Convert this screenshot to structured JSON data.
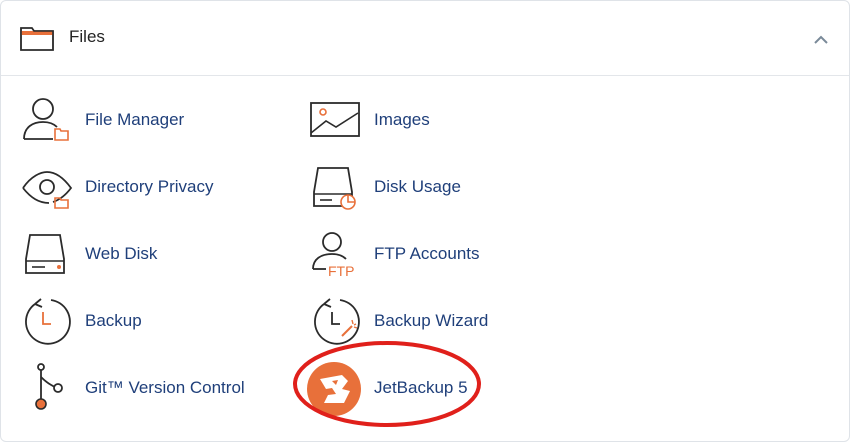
{
  "section": {
    "title": "Files",
    "collapse_icon": "chevron-up-icon",
    "header_icon": "folder-icon"
  },
  "colors": {
    "accent": "#e8703a",
    "link": "#1f3f7a",
    "icon_stroke": "#2b2b2b",
    "highlight": "#e0201b"
  },
  "items": [
    {
      "label": "File Manager",
      "icon": "file-manager-icon"
    },
    {
      "label": "Images",
      "icon": "images-icon"
    },
    {
      "label": "Directory Privacy",
      "icon": "directory-privacy-icon"
    },
    {
      "label": "Disk Usage",
      "icon": "disk-usage-icon"
    },
    {
      "label": "Web Disk",
      "icon": "web-disk-icon"
    },
    {
      "label": "FTP Accounts",
      "icon": "ftp-accounts-icon"
    },
    {
      "label": "Backup",
      "icon": "backup-icon"
    },
    {
      "label": "Backup Wizard",
      "icon": "backup-wizard-icon"
    },
    {
      "label": "Git™ Version Control",
      "icon": "git-icon"
    },
    {
      "label": "JetBackup 5",
      "icon": "jetbackup-icon"
    }
  ],
  "ftp_icon_text": "FTP"
}
